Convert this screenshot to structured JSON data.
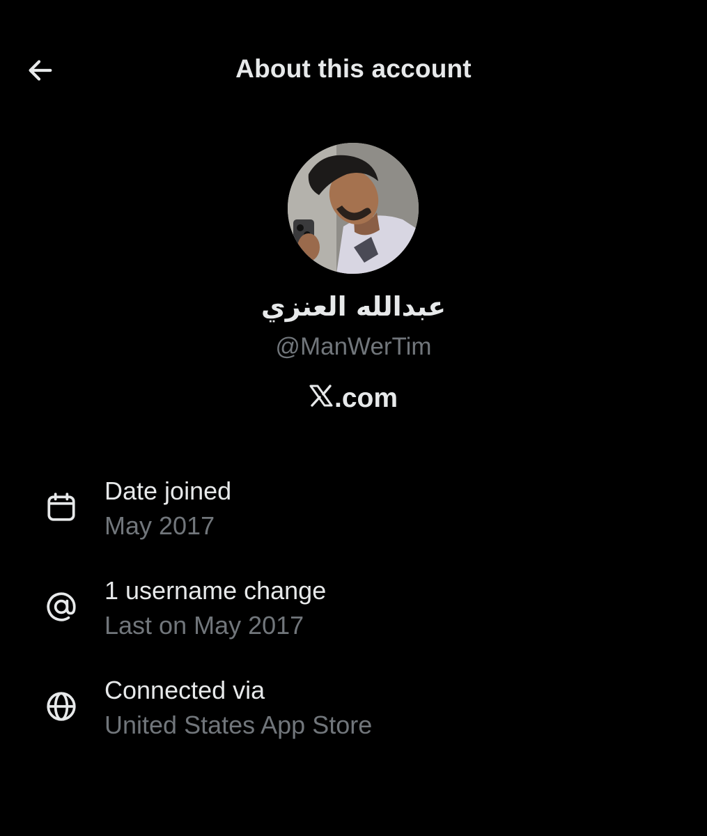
{
  "header": {
    "title": "About this account",
    "back_icon": "arrow-left-icon"
  },
  "profile": {
    "display_name": "عبدالله العنزي",
    "handle": "@ManWerTim",
    "site_suffix": ".com",
    "site_logo": "x-logo-icon"
  },
  "details": [
    {
      "icon": "calendar-icon",
      "title": "Date joined",
      "subtitle": "May 2017"
    },
    {
      "icon": "at-sign-icon",
      "title": "1 username change",
      "subtitle": "Last on May 2017"
    },
    {
      "icon": "globe-icon",
      "title": "Connected via",
      "subtitle": "United States App Store"
    }
  ],
  "colors": {
    "background": "#000000",
    "primary_text": "#e7e9ea",
    "secondary_text": "#71767b"
  }
}
